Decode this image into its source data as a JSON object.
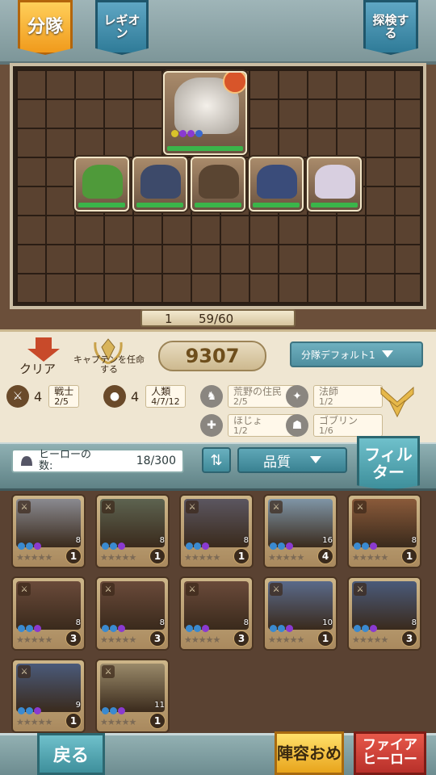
{
  "tabs": {
    "squad": "分隊",
    "legion": "レギオン",
    "explore": "探検する"
  },
  "formation": {
    "captain_color": "#e8e3dd",
    "front_row": [
      "goblin-hero",
      "armored-knight",
      "ranger-hero",
      "blue-knight",
      "nun-hero"
    ]
  },
  "count": {
    "left": "1",
    "value": "59/60"
  },
  "actions": {
    "clear_label": "クリア",
    "captain_label": "キャプテンを任命する",
    "power": "9307",
    "squad_select": "分隊デフォルト1"
  },
  "synergies": [
    {
      "icon": "sword-shield-icon",
      "count": "4",
      "name": "戦士",
      "progress": "2/5",
      "active": true
    },
    {
      "icon": "human-head-icon",
      "count": "4",
      "name": "人類",
      "progress": "4/7/12",
      "active": true
    },
    {
      "icon": "wilderness-icon",
      "name": "荒野の住民",
      "progress": "2/5",
      "active": false
    },
    {
      "icon": "mage-icon",
      "name": "法師",
      "progress": "1/2",
      "active": false
    },
    {
      "icon": "support-icon",
      "name": "ほじょ",
      "progress": "1/2",
      "active": false
    },
    {
      "icon": "goblin-icon",
      "name": "ゴブリン",
      "progress": "1/6",
      "active": false
    }
  ],
  "herobar": {
    "count_label": "ヒーローの数:",
    "count_value": "18/300",
    "quality_label": "品質",
    "filter_label": "フィルター"
  },
  "heroes": [
    {
      "level": "1",
      "cost": "8",
      "color": "#8a8a90"
    },
    {
      "level": "1",
      "cost": "8",
      "color": "#5d6350"
    },
    {
      "level": "1",
      "cost": "8",
      "color": "#5b5660"
    },
    {
      "level": "4",
      "cost": "16",
      "color": "#7f95a6"
    },
    {
      "level": "1",
      "cost": "8",
      "color": "#8a5a3a"
    },
    {
      "level": "3",
      "cost": "8",
      "color": "#6a4a3a"
    },
    {
      "level": "3",
      "cost": "8",
      "color": "#6a4a3a"
    },
    {
      "level": "3",
      "cost": "8",
      "color": "#6a4a3a"
    },
    {
      "level": "1",
      "cost": "10",
      "color": "#5a6a8a"
    },
    {
      "level": "3",
      "cost": "8",
      "color": "#4a5a7a"
    },
    {
      "level": "1",
      "cost": "9",
      "color": "#4a5a7a"
    },
    {
      "level": "1",
      "cost": "11",
      "color": "#9a8a6a"
    }
  ],
  "bottom": {
    "back_label": "戻る",
    "recommend_label": "陣容おめ",
    "fire_label": "ファイアヒーロー"
  }
}
